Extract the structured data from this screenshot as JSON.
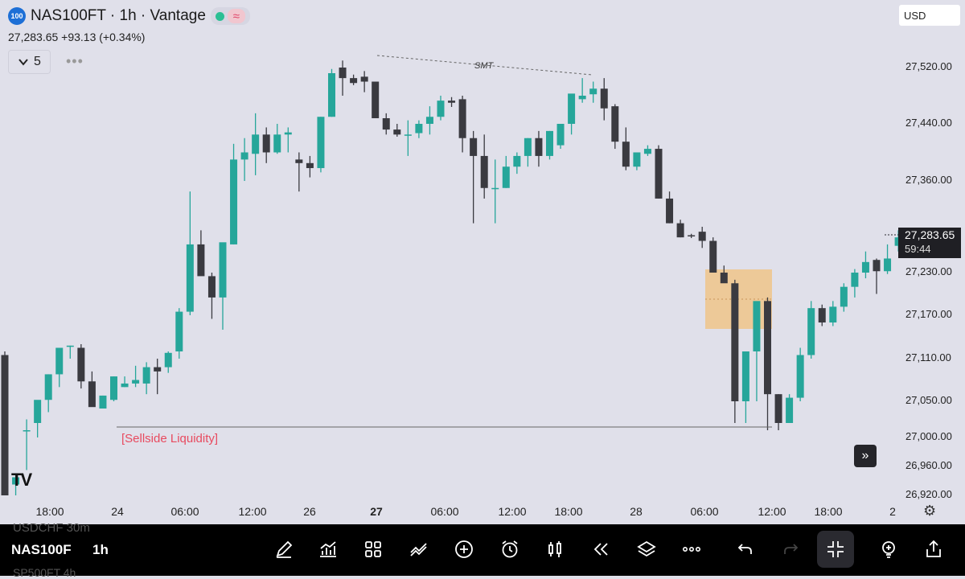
{
  "header": {
    "symbol_badge": "100",
    "title": "NAS100FT · 1h · Vantage",
    "price_line": "27,283.65  +93.13 (+0.34%)",
    "indicator_count": "5",
    "currency": "USD"
  },
  "price_scale": {
    "labels": [
      "27,520.00",
      "27,440.00",
      "27,360.00",
      "27,230.00",
      "27,170.00",
      "27,110.00",
      "27,050.00",
      "27,000.00",
      "26,960.00",
      "26,920.00"
    ],
    "current_price": "27,283.65",
    "countdown": "59:44"
  },
  "time_axis": {
    "labels": [
      "18:00",
      "24",
      "06:00",
      "12:00",
      "26",
      "27",
      "06:00",
      "12:00",
      "18:00",
      "28",
      "06:00",
      "12:00",
      "18:00",
      "2"
    ]
  },
  "annotations": {
    "smt_label": "SMT",
    "sellside_label": "[Sellside Liquidity]"
  },
  "colors": {
    "bull": "#26a69a",
    "bear": "#3a3a40",
    "zone": "#efc48a",
    "sellside_text": "#e84a5f"
  },
  "chart_data": {
    "type": "candlestick",
    "y_ticks": [
      27520,
      27440,
      27360,
      27230,
      27170,
      27110,
      27050,
      27000,
      26960,
      26920
    ],
    "candles": [
      {
        "o": 27115,
        "h": 27120,
        "l": 26920,
        "c": 26920
      },
      {
        "o": 26935,
        "h": 26950,
        "l": 26920,
        "c": 26945
      },
      {
        "o": 27010,
        "h": 27025,
        "l": 26955,
        "c": 27010
      },
      {
        "o": 27020,
        "h": 27045,
        "l": 27000,
        "c": 27052
      },
      {
        "o": 27052,
        "h": 27088,
        "l": 27035,
        "c": 27088
      },
      {
        "o": 27088,
        "h": 27125,
        "l": 27070,
        "c": 27125
      },
      {
        "o": 27128,
        "h": 27128,
        "l": 27110,
        "c": 27128
      },
      {
        "o": 27125,
        "h": 27130,
        "l": 27068,
        "c": 27078
      },
      {
        "o": 27078,
        "h": 27092,
        "l": 27045,
        "c": 27042
      },
      {
        "o": 27040,
        "h": 27058,
        "l": 27040,
        "c": 27058
      },
      {
        "o": 27052,
        "h": 27085,
        "l": 27050,
        "c": 27085
      },
      {
        "o": 27070,
        "h": 27085,
        "l": 27070,
        "c": 27075
      },
      {
        "o": 27075,
        "h": 27100,
        "l": 27070,
        "c": 27080
      },
      {
        "o": 27075,
        "h": 27105,
        "l": 27060,
        "c": 27098
      },
      {
        "o": 27098,
        "h": 27110,
        "l": 27060,
        "c": 27092
      },
      {
        "o": 27098,
        "h": 27120,
        "l": 27090,
        "c": 27118
      },
      {
        "o": 27120,
        "h": 27180,
        "l": 27110,
        "c": 27175
      },
      {
        "o": 27175,
        "h": 27345,
        "l": 27170,
        "c": 27270
      },
      {
        "o": 27270,
        "h": 27290,
        "l": 27230,
        "c": 27225
      },
      {
        "o": 27225,
        "h": 27230,
        "l": 27165,
        "c": 27195
      },
      {
        "o": 27195,
        "h": 27260,
        "l": 27150,
        "c": 27273
      },
      {
        "o": 27270,
        "h": 27412,
        "l": 27270,
        "c": 27390
      },
      {
        "o": 27390,
        "h": 27420,
        "l": 27360,
        "c": 27400
      },
      {
        "o": 27398,
        "h": 27455,
        "l": 27368,
        "c": 27425
      },
      {
        "o": 27425,
        "h": 27435,
        "l": 27385,
        "c": 27400
      },
      {
        "o": 27400,
        "h": 27440,
        "l": 27398,
        "c": 27425
      },
      {
        "o": 27425,
        "h": 27435,
        "l": 27400,
        "c": 27428
      },
      {
        "o": 27390,
        "h": 27400,
        "l": 27345,
        "c": 27385
      },
      {
        "o": 27385,
        "h": 27395,
        "l": 27365,
        "c": 27378
      },
      {
        "o": 27378,
        "h": 27450,
        "l": 27372,
        "c": 27450
      },
      {
        "o": 27450,
        "h": 27518,
        "l": 27450,
        "c": 27512
      },
      {
        "o": 27520,
        "h": 27530,
        "l": 27480,
        "c": 27505
      },
      {
        "o": 27505,
        "h": 27510,
        "l": 27495,
        "c": 27498
      },
      {
        "o": 27507,
        "h": 27515,
        "l": 27485,
        "c": 27500
      },
      {
        "o": 27500,
        "h": 27500,
        "l": 27452,
        "c": 27448
      },
      {
        "o": 27448,
        "h": 27455,
        "l": 27425,
        "c": 27432
      },
      {
        "o": 27432,
        "h": 27440,
        "l": 27422,
        "c": 27425
      },
      {
        "o": 27425,
        "h": 27445,
        "l": 27395,
        "c": 27425
      },
      {
        "o": 27427,
        "h": 27445,
        "l": 27420,
        "c": 27440
      },
      {
        "o": 27440,
        "h": 27465,
        "l": 27425,
        "c": 27450
      },
      {
        "o": 27450,
        "h": 27480,
        "l": 27445,
        "c": 27473
      },
      {
        "o": 27473,
        "h": 27478,
        "l": 27464,
        "c": 27470
      },
      {
        "o": 27475,
        "h": 27480,
        "l": 27400,
        "c": 27420
      },
      {
        "o": 27420,
        "h": 27430,
        "l": 27300,
        "c": 27395
      },
      {
        "o": 27395,
        "h": 27425,
        "l": 27335,
        "c": 27350
      },
      {
        "o": 27350,
        "h": 27390,
        "l": 27300,
        "c": 27350
      },
      {
        "o": 27350,
        "h": 27395,
        "l": 27350,
        "c": 27380
      },
      {
        "o": 27380,
        "h": 27400,
        "l": 27370,
        "c": 27395
      },
      {
        "o": 27395,
        "h": 27420,
        "l": 27380,
        "c": 27420
      },
      {
        "o": 27420,
        "h": 27430,
        "l": 27380,
        "c": 27395
      },
      {
        "o": 27395,
        "h": 27430,
        "l": 27390,
        "c": 27430
      },
      {
        "o": 27410,
        "h": 27440,
        "l": 27405,
        "c": 27440
      },
      {
        "o": 27440,
        "h": 27475,
        "l": 27425,
        "c": 27483
      },
      {
        "o": 27475,
        "h": 27505,
        "l": 27470,
        "c": 27480
      },
      {
        "o": 27482,
        "h": 27500,
        "l": 27470,
        "c": 27490
      },
      {
        "o": 27490,
        "h": 27505,
        "l": 27445,
        "c": 27462
      },
      {
        "o": 27465,
        "h": 27468,
        "l": 27405,
        "c": 27415
      },
      {
        "o": 27415,
        "h": 27435,
        "l": 27375,
        "c": 27380
      },
      {
        "o": 27380,
        "h": 27400,
        "l": 27375,
        "c": 27400
      },
      {
        "o": 27398,
        "h": 27410,
        "l": 27395,
        "c": 27405
      },
      {
        "o": 27405,
        "h": 27410,
        "l": 27335,
        "c": 27335
      },
      {
        "o": 27335,
        "h": 27345,
        "l": 27300,
        "c": 27300
      },
      {
        "o": 27300,
        "h": 27305,
        "l": 27280,
        "c": 27280
      },
      {
        "o": 27283,
        "h": 27285,
        "l": 27279,
        "c": 27282
      },
      {
        "o": 27288,
        "h": 27295,
        "l": 27265,
        "c": 27275
      },
      {
        "o": 27275,
        "h": 27280,
        "l": 27230,
        "c": 27230
      },
      {
        "o": 27230,
        "h": 27240,
        "l": 27225,
        "c": 27215
      },
      {
        "o": 27215,
        "h": 27220,
        "l": 27020,
        "c": 27050
      },
      {
        "o": 27050,
        "h": 27110,
        "l": 27020,
        "c": 27120
      },
      {
        "o": 27120,
        "h": 27140,
        "l": 27050,
        "c": 27190
      },
      {
        "o": 27190,
        "h": 27195,
        "l": 27010,
        "c": 27060
      },
      {
        "o": 27060,
        "h": 27060,
        "l": 27010,
        "c": 27020
      },
      {
        "o": 27020,
        "h": 27060,
        "l": 27035,
        "c": 27055
      },
      {
        "o": 27055,
        "h": 27125,
        "l": 27050,
        "c": 27115
      },
      {
        "o": 27115,
        "h": 27190,
        "l": 27110,
        "c": 27180
      },
      {
        "o": 27180,
        "h": 27185,
        "l": 27155,
        "c": 27160
      },
      {
        "o": 27160,
        "h": 27190,
        "l": 27155,
        "c": 27182
      },
      {
        "o": 27182,
        "h": 27215,
        "l": 27175,
        "c": 27210
      },
      {
        "o": 27210,
        "h": 27235,
        "l": 27195,
        "c": 27230
      },
      {
        "o": 27230,
        "h": 27260,
        "l": 27222,
        "c": 27245
      },
      {
        "o": 27248,
        "h": 27250,
        "l": 27200,
        "c": 27232
      },
      {
        "o": 27232,
        "h": 27270,
        "l": 27228,
        "c": 27250
      },
      {
        "o": 27268,
        "h": 27290,
        "l": 27260,
        "c": 27280
      }
    ]
  },
  "toolbar": {
    "symbol": "NAS100F",
    "interval": "1h",
    "ghost_top": "USDCHF    30m",
    "ghost_bottom": "SP500FT    4h"
  }
}
